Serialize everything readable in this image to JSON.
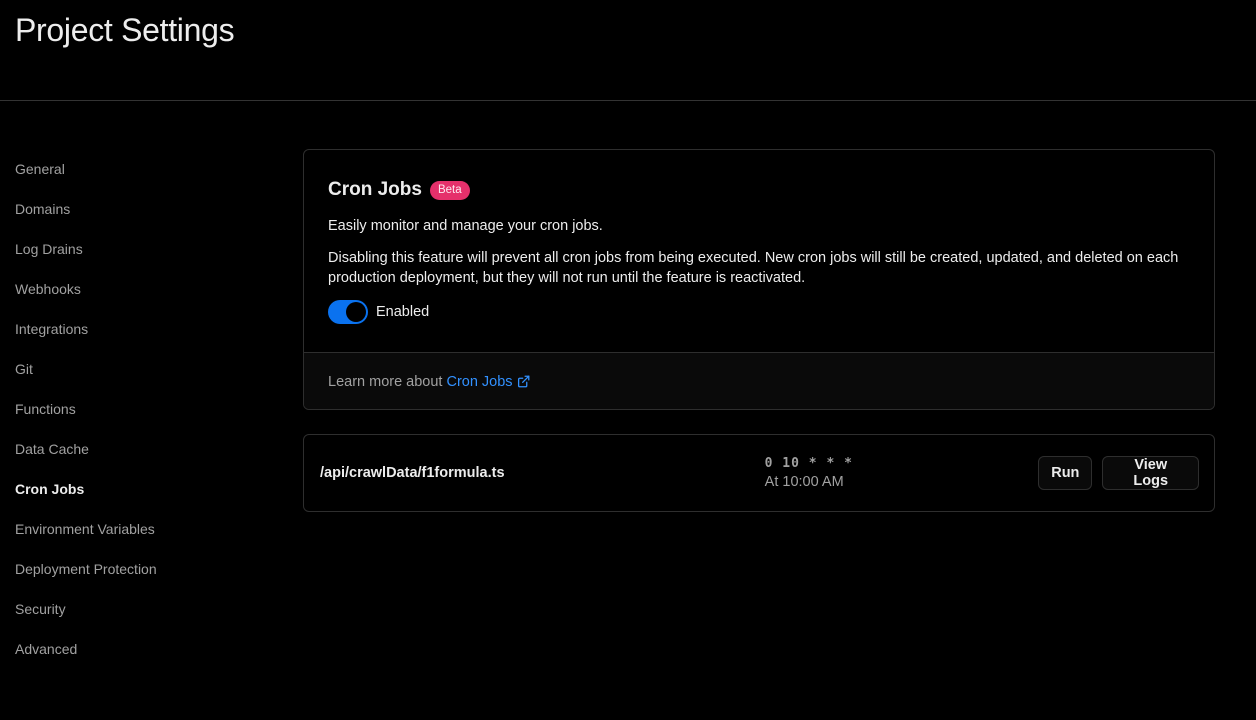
{
  "header": {
    "title": "Project Settings"
  },
  "sidebar": {
    "items": [
      {
        "label": "General"
      },
      {
        "label": "Domains"
      },
      {
        "label": "Log Drains"
      },
      {
        "label": "Webhooks"
      },
      {
        "label": "Integrations"
      },
      {
        "label": "Git"
      },
      {
        "label": "Functions"
      },
      {
        "label": "Data Cache"
      },
      {
        "label": "Cron Jobs"
      },
      {
        "label": "Environment Variables"
      },
      {
        "label": "Deployment Protection"
      },
      {
        "label": "Security"
      },
      {
        "label": "Advanced"
      }
    ],
    "active": "Cron Jobs"
  },
  "cron_card": {
    "title": "Cron Jobs",
    "badge": "Beta",
    "description": "Easily monitor and manage your cron jobs.",
    "warning": "Disabling this feature will prevent all cron jobs from being executed. New cron jobs will still be created, updated, and deleted on each production deployment, but they will not run until the feature is reactivated.",
    "toggle": {
      "enabled": true,
      "label": "Enabled"
    },
    "footer": {
      "prefix": "Learn more about",
      "link_text": "Cron Jobs"
    }
  },
  "cron_jobs": [
    {
      "path": "/api/crawlData/f1formula.ts",
      "schedule": "0 10 * * *",
      "schedule_human": "At 10:00 AM",
      "run_label": "Run",
      "logs_label": "View Logs"
    }
  ],
  "colors": {
    "background": "#000000",
    "accent": "#0a72ef",
    "link": "#3291ff",
    "badge": "#e5306b",
    "border": "#2e2e2e"
  },
  "icons": {
    "external_link": "external-link-icon"
  }
}
